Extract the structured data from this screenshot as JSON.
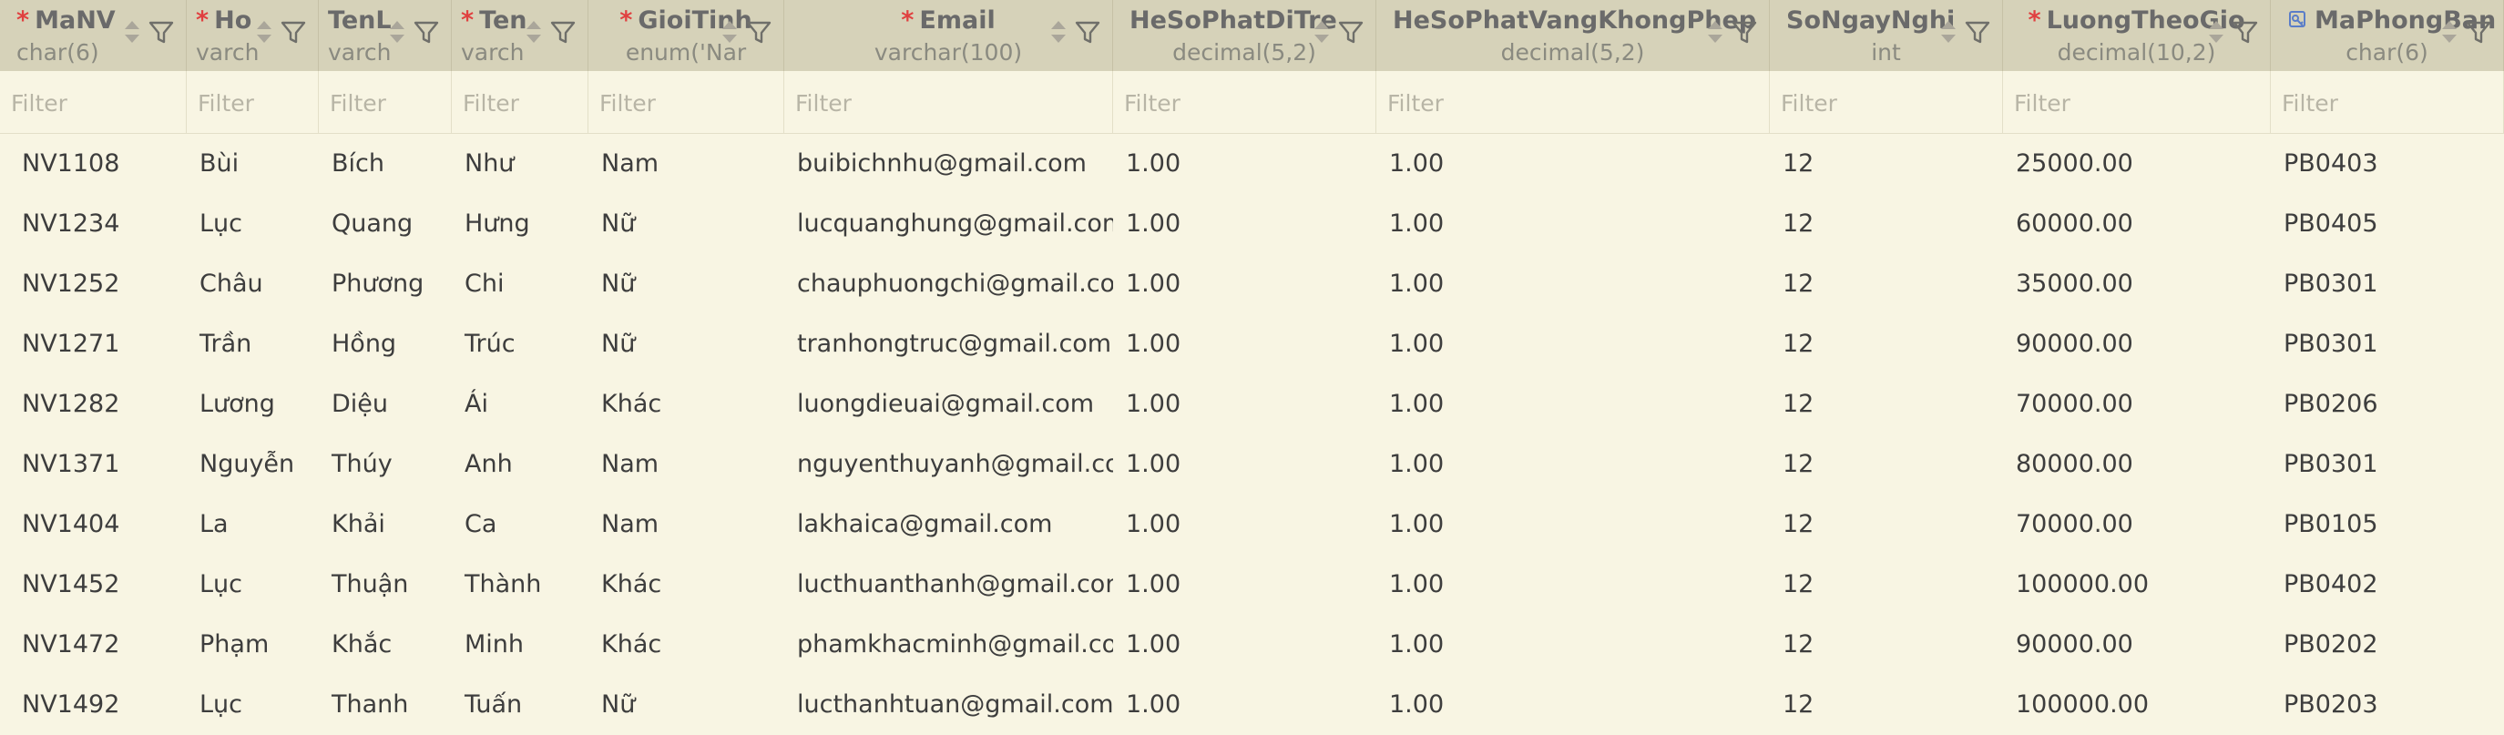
{
  "filter_placeholder": "Filter",
  "columns": [
    {
      "name": "MaNV",
      "type": "char(6)",
      "required": true
    },
    {
      "name": "Ho",
      "type": "varch",
      "required": true
    },
    {
      "name": "TenL",
      "type": "varch",
      "required": false
    },
    {
      "name": "Ten",
      "type": "varch",
      "required": true
    },
    {
      "name": "GioiTinh",
      "type": "enum('Nar",
      "required": true
    },
    {
      "name": "Email",
      "type": "varchar(100)",
      "required": true
    },
    {
      "name": "HeSoPhatDiTre",
      "type": "decimal(5,2)",
      "required": false
    },
    {
      "name": "HeSoPhatVangKhongPhep",
      "type": "decimal(5,2)",
      "required": false
    },
    {
      "name": "SoNgayNghi",
      "type": "int",
      "required": false
    },
    {
      "name": "LuongTheoGio",
      "type": "decimal(10,2)",
      "required": true
    },
    {
      "name": "MaPhongBan",
      "type": "char(6)",
      "required": false,
      "foreign_key": true
    }
  ],
  "rows": [
    [
      "NV1108",
      "Bùi",
      "Bích",
      "Như",
      "Nam",
      "buibichnhu@gmail.com",
      "1.00",
      "1.00",
      "12",
      "25000.00",
      "PB0403"
    ],
    [
      "NV1234",
      "Lục",
      "Quang",
      "Hưng",
      "Nữ",
      "lucquanghung@gmail.com",
      "1.00",
      "1.00",
      "12",
      "60000.00",
      "PB0405"
    ],
    [
      "NV1252",
      "Châu",
      "Phương",
      "Chi",
      "Nữ",
      "chauphuongchi@gmail.com",
      "1.00",
      "1.00",
      "12",
      "35000.00",
      "PB0301"
    ],
    [
      "NV1271",
      "Trần",
      "Hồng",
      "Trúc",
      "Nữ",
      "tranhongtruc@gmail.com",
      "1.00",
      "1.00",
      "12",
      "90000.00",
      "PB0301"
    ],
    [
      "NV1282",
      "Lương",
      "Diệu",
      "Ái",
      "Khác",
      "luongdieuai@gmail.com",
      "1.00",
      "1.00",
      "12",
      "70000.00",
      "PB0206"
    ],
    [
      "NV1371",
      "Nguyễn",
      "Thúy",
      "Anh",
      "Nam",
      "nguyenthuyanh@gmail.com",
      "1.00",
      "1.00",
      "12",
      "80000.00",
      "PB0301"
    ],
    [
      "NV1404",
      "La",
      "Khải",
      "Ca",
      "Nam",
      "lakhaica@gmail.com",
      "1.00",
      "1.00",
      "12",
      "70000.00",
      "PB0105"
    ],
    [
      "NV1452",
      "Lục",
      "Thuận",
      "Thành",
      "Khác",
      "lucthuanthanh@gmail.com",
      "1.00",
      "1.00",
      "12",
      "100000.00",
      "PB0402"
    ],
    [
      "NV1472",
      "Phạm",
      "Khắc",
      "Minh",
      "Khác",
      "phamkhacminh@gmail.com",
      "1.00",
      "1.00",
      "12",
      "90000.00",
      "PB0202"
    ],
    [
      "NV1492",
      "Lục",
      "Thanh",
      "Tuấn",
      "Nữ",
      "lucthanhtuan@gmail.com",
      "1.00",
      "1.00",
      "12",
      "100000.00",
      "PB0203"
    ]
  ]
}
